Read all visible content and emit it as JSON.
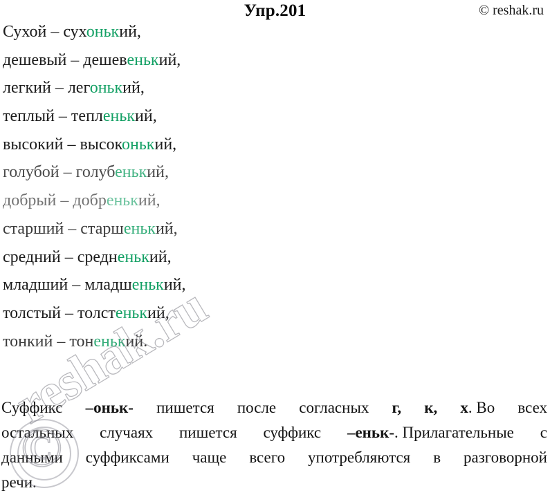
{
  "header": {
    "title": "Упр.201",
    "copyright": "© reshak.ru"
  },
  "word_pairs": [
    {
      "base": "Сухой – сух",
      "suffix": "оньк",
      "tail": "ий,",
      "fade": ""
    },
    {
      "base": "дешевый – дешев",
      "suffix": "еньк",
      "tail": "ий,",
      "fade": ""
    },
    {
      "base": "легкий – лег",
      "suffix": "оньк",
      "tail": "ий,",
      "fade": ""
    },
    {
      "base": "теплый – тепл",
      "suffix": "еньк",
      "tail": "ий,",
      "fade": ""
    },
    {
      "base": "высокий – высок",
      "suffix": "оньк",
      "tail": "ий,",
      "fade": ""
    },
    {
      "base": "голубой – голуб",
      "suffix": "еньк",
      "tail": "ий,",
      "fade": "fade-1"
    },
    {
      "base": "добрый – добр",
      "suffix": "еньк",
      "tail": "ий,",
      "fade": "fade-2"
    },
    {
      "base": "старший – старш",
      "suffix": "еньк",
      "tail": "ий,",
      "fade": "fade-3"
    },
    {
      "base": "средний – средн",
      "suffix": "еньк",
      "tail": "ий,",
      "fade": ""
    },
    {
      "base": "младший – младш",
      "suffix": "еньк",
      "tail": "ий,",
      "fade": ""
    },
    {
      "base": "толстый – толст",
      "suffix": "еньк",
      "tail": "ий,",
      "fade": ""
    },
    {
      "base": "тонкий – тон",
      "suffix": "еньк",
      "tail": "ий.",
      "fade": "fade-3"
    }
  ],
  "rule": {
    "line1": {
      "w1": "Суффикс",
      "w2_bold": "–оньк-",
      "w3": "пишется",
      "w4": "после",
      "w5": "согласных",
      "w6_bold": "г,",
      "w7_bold": "к,",
      "w8_bold": "х",
      "w9": ". Во",
      "w10": "всех"
    },
    "line2": {
      "w1": "остальных",
      "w2": "случаях",
      "w3": "пишется",
      "w4": "суффикс",
      "w5_bold": "–еньк-",
      "w6": ". Прилагательные",
      "w7": "с"
    },
    "line3": {
      "w1": "данными",
      "w2": "суффиксами",
      "w3": "чаще",
      "w4": "всего",
      "w5": "употребляются",
      "w6": "в",
      "w7": "разговорной"
    },
    "line4": {
      "w1": "речи."
    }
  },
  "watermark": {
    "text": "reshak.ru",
    "glyph": "©"
  },
  "colors": {
    "suffix_green": "#13a064",
    "body_text": "#1a1a1a",
    "watermark_stroke": "#7d7d87"
  }
}
